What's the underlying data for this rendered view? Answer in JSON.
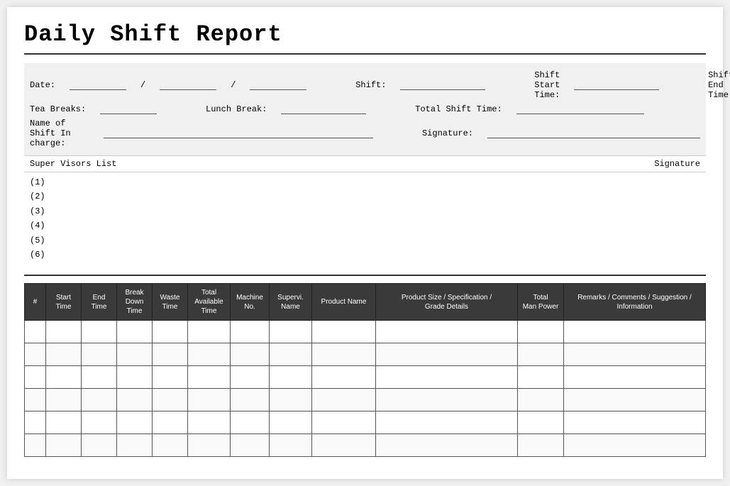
{
  "title": "Daily Shift Report",
  "header": {
    "date_label": "Date:",
    "date_slash1": "/",
    "date_slash2": "/",
    "shift_label": "Shift:",
    "shift_start_label": "Shift Start Time:",
    "shift_end_label": "Shift End Time:",
    "tea_breaks_label": "Tea Breaks:",
    "lunch_break_label": "Lunch Break:",
    "total_shift_label": "Total Shift Time:",
    "name_label": "Name of Shift In charge:",
    "signature_label": "Signature:"
  },
  "supervisors": {
    "list_label": "Super Visors List",
    "signature_label": "Signature",
    "items": [
      "(1)",
      "(2)",
      "(3)",
      "(4)",
      "(5)",
      "(6)"
    ]
  },
  "table": {
    "columns": [
      "#",
      "Start\nTime",
      "End\nTime",
      "Break\nDown\nTime",
      "Waste\nTime",
      "Total\nAvailable\nTime",
      "Machine\nNo.",
      "Supervi.\nName",
      "Product Name",
      "Product Size / Specification /\nGrade Details",
      "Total\nMan Power",
      "Remarks / Comments / Suggestion /\nInformation"
    ],
    "rows": [
      [
        "",
        "",
        "",
        "",
        "",
        "",
        "",
        "",
        "",
        "",
        "",
        ""
      ],
      [
        "",
        "",
        "",
        "",
        "",
        "",
        "",
        "",
        "",
        "",
        "",
        ""
      ],
      [
        "",
        "",
        "",
        "",
        "",
        "",
        "",
        "",
        "",
        "",
        "",
        ""
      ],
      [
        "",
        "",
        "",
        "",
        "",
        "",
        "",
        "",
        "",
        "",
        "",
        ""
      ],
      [
        "",
        "",
        "",
        "",
        "",
        "",
        "",
        "",
        "",
        "",
        "",
        ""
      ],
      [
        "",
        "",
        "",
        "",
        "",
        "",
        "",
        "",
        "",
        "",
        "",
        ""
      ]
    ]
  }
}
